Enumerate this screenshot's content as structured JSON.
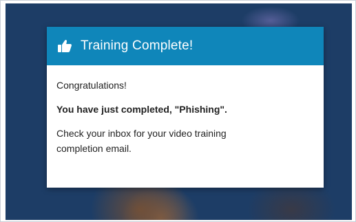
{
  "modal": {
    "icon": "thumbs-up-icon",
    "title": "Training Complete!",
    "congrats": "Congratulations!",
    "completion_message": "You have just completed, \"Phishing\".",
    "email_message": "Check your inbox for your video training completion email."
  },
  "colors": {
    "header": "#0f86ba",
    "backdrop": "#1e3f68",
    "body_text": "#222222"
  }
}
